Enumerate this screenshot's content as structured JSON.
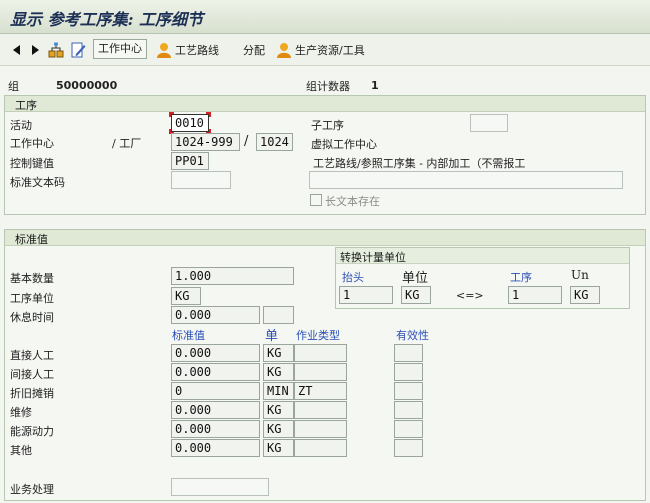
{
  "window": {
    "title": "显示 参考工序集: 工序细节"
  },
  "toolbar": {
    "back_icon": "triangle-left-icon",
    "forward_icon": "triangle-right-icon",
    "work_center_label": "工作中心",
    "routing_label": "工艺路线",
    "allocation_label": "分配",
    "prt_label": "生产资源/工具"
  },
  "header": {
    "group_label": "组",
    "group_value": "50000000",
    "group_counter_label": "组计数器",
    "group_counter_value": "1"
  },
  "operation": {
    "section_title": "工序",
    "activity_label": "活动",
    "activity_value": "0010",
    "sub_operation_label": "子工序",
    "sub_operation_value": "",
    "work_center_label": "工作中心",
    "plant_label": "/ 工厂",
    "work_center_value": "1024-999",
    "slash": "/",
    "plant_value": "1024",
    "virtual_wc_label": "虚拟工作中心",
    "control_key_label": "控制键值",
    "control_key_value": "PP01",
    "control_key_desc": "工艺路线/参照工序集 - 内部加工（不需报工",
    "std_text_label": "标准文本码",
    "std_text_value": "",
    "desc_value": "",
    "long_text_label": "长文本存在"
  },
  "standard_values": {
    "section_title": "标准值",
    "base_qty_label": "基本数量",
    "base_qty_value": "1.000",
    "op_unit_label": "工序单位",
    "op_unit_value": "KG",
    "break_label": "休息时间",
    "break_value": "0.000",
    "break_unit": "",
    "col_std_value": "标准值",
    "col_unit": "单",
    "col_activity_type": "作业类型",
    "col_effectivity": "有效性",
    "rows": [
      {
        "label": "直接人工",
        "value": "0.000",
        "unit": "KG",
        "activity_type": ""
      },
      {
        "label": "间接人工",
        "value": "0.000",
        "unit": "KG",
        "activity_type": ""
      },
      {
        "label": "折旧摊销",
        "value": "0",
        "unit": "MIN",
        "activity_type": "ZT"
      },
      {
        "label": "维修",
        "value": "0.000",
        "unit": "KG",
        "activity_type": ""
      },
      {
        "label": "能源动力",
        "value": "0.000",
        "unit": "KG",
        "activity_type": ""
      },
      {
        "label": "其他",
        "value": "0.000",
        "unit": "KG",
        "activity_type": ""
      }
    ],
    "business_process_label": "业务处理",
    "business_process_value": ""
  },
  "conversion": {
    "title": "转换计量单位",
    "header_label": "抬头",
    "unit_label": "单位",
    "operation_label": "工序",
    "un_label": "Un",
    "header_qty": "1",
    "header_unit": "KG",
    "equals": "<=>",
    "op_qty": "1",
    "op_unit": "KG"
  },
  "colors": {
    "accent_blue": "#2b4fb8",
    "focus_red": "#d62020",
    "title_navy": "#1d2f55"
  }
}
